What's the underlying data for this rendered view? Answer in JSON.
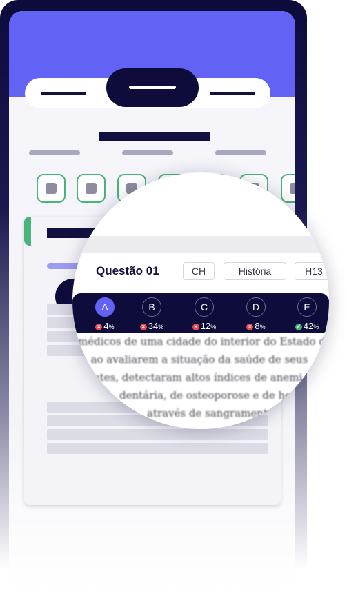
{
  "question": {
    "title": "Questão 01",
    "tags": [
      "CH",
      "História",
      "H13"
    ]
  },
  "options": [
    {
      "letter": "A",
      "percent": "4",
      "result": "wrong",
      "selected": true
    },
    {
      "letter": "B",
      "percent": "34",
      "result": "wrong",
      "selected": false
    },
    {
      "letter": "C",
      "percent": "12",
      "result": "wrong",
      "selected": false
    },
    {
      "letter": "D",
      "percent": "8",
      "result": "wrong",
      "selected": false
    },
    {
      "letter": "E",
      "percent": "42",
      "result": "right",
      "selected": false
    }
  ],
  "percent_sign": "%",
  "passage": [
    "médicos de uma cidade do interior do Estado d",
    "o, ao avaliarem a situação da saúde de seus",
    "ntes, detectaram altos índices de anemi",
    "dentária, de osteoporose e de hem",
    "através de sangramentos no"
  ],
  "icons": {
    "wrong": "close-icon",
    "right": "check-icon"
  },
  "colors": {
    "header": "#6262f5",
    "dark": "#0e0c3a",
    "correct": "#48b47a",
    "wrong": "#e5484d"
  }
}
